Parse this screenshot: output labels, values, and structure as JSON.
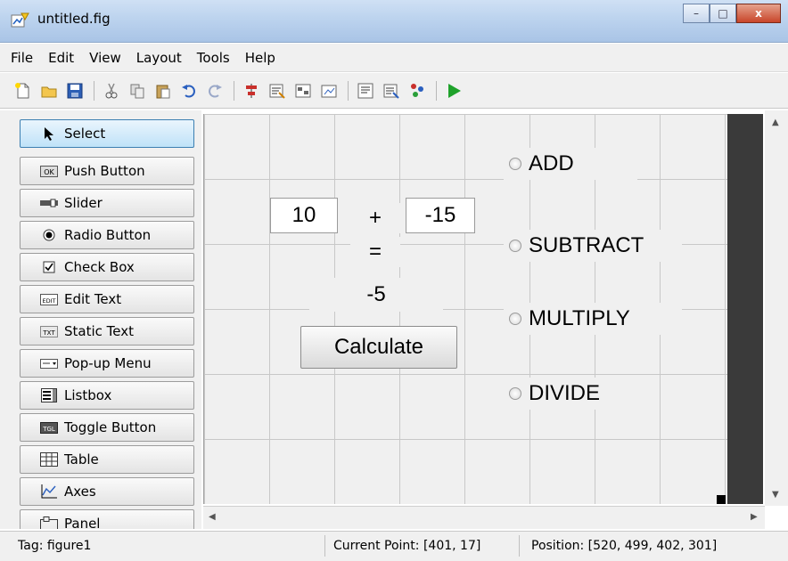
{
  "window": {
    "title": "untitled.fig",
    "minimize_label": "–",
    "maximize_label": "□",
    "close_label": "x"
  },
  "menu": [
    "File",
    "Edit",
    "View",
    "Layout",
    "Tools",
    "Help"
  ],
  "toolbar": {
    "icons": [
      "new-file-icon",
      "open-folder-icon",
      "save-icon",
      "cut-icon",
      "copy-icon",
      "paste-icon",
      "undo-icon",
      "redo-icon",
      "align-objects-icon",
      "menu-editor-icon",
      "tab-order-icon",
      "toolbar-editor-icon",
      "editor-icon",
      "property-inspector-icon",
      "object-browser-icon",
      "run-figure-icon"
    ]
  },
  "palette": {
    "items": [
      {
        "label": "Select",
        "icon": "arrow-pointer-icon",
        "selected": true
      },
      {
        "label": "Push Button",
        "icon": "push-button-icon",
        "selected": false
      },
      {
        "label": "Slider",
        "icon": "slider-icon",
        "selected": false
      },
      {
        "label": "Radio Button",
        "icon": "radio-button-icon",
        "selected": false
      },
      {
        "label": "Check Box",
        "icon": "check-box-icon",
        "selected": false
      },
      {
        "label": "Edit Text",
        "icon": "edit-text-icon",
        "selected": false
      },
      {
        "label": "Static Text",
        "icon": "static-text-icon",
        "selected": false
      },
      {
        "label": "Pop-up Menu",
        "icon": "popup-menu-icon",
        "selected": false
      },
      {
        "label": "Listbox",
        "icon": "listbox-icon",
        "selected": false
      },
      {
        "label": "Toggle Button",
        "icon": "toggle-button-icon",
        "selected": false
      },
      {
        "label": "Table",
        "icon": "table-icon",
        "selected": false
      },
      {
        "label": "Axes",
        "icon": "axes-icon",
        "selected": false
      },
      {
        "label": "Panel",
        "icon": "panel-icon",
        "selected": false
      }
    ],
    "icon_text": {
      "push": "OK",
      "edit": "EDIT",
      "static": "TXT",
      "toggle": "TGL"
    }
  },
  "canvas": {
    "input_a": "10",
    "operator": "+",
    "input_b": "-15",
    "equals": "=",
    "result": "-5",
    "calculate_label": "Calculate",
    "radios": [
      "ADD",
      "SUBTRACT",
      "MULTIPLY",
      "DIVIDE"
    ]
  },
  "statusbar": {
    "tag": "Tag: figure1",
    "current_point": "Current Point:  [401, 17]",
    "position": "Position: [520, 499, 402, 301]"
  },
  "colors": {
    "titlebar": "#bcd3ee",
    "selected_tool": "#bfe2f8",
    "canvas_bg": "#f0f0f0",
    "run_green": "#1fa22b"
  }
}
